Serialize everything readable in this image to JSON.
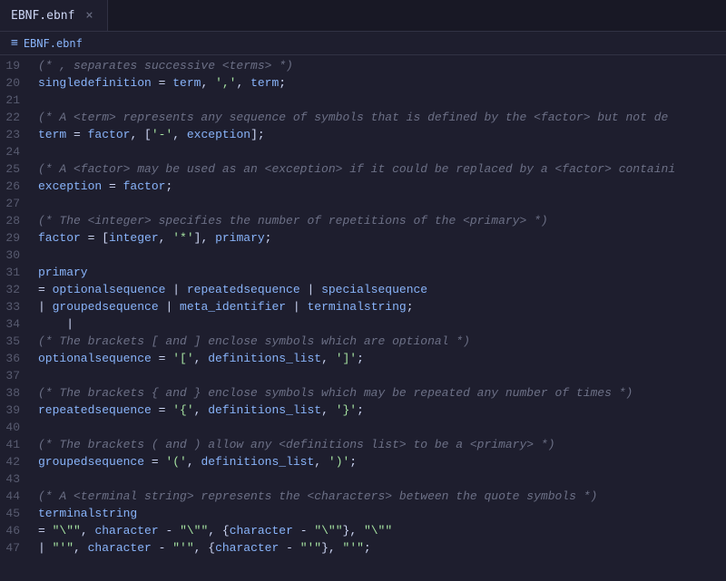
{
  "tab": {
    "label": "EBNF.ebnf",
    "close": "×"
  },
  "breadcrumb": {
    "icon": "≡",
    "path": "EBNF.ebnf"
  },
  "lines": [
    {
      "num": "19",
      "content": [
        {
          "t": "comment",
          "v": "(* , separates successive <terms> *)"
        }
      ]
    },
    {
      "num": "20",
      "content": [
        {
          "t": "identifier",
          "v": "singledefinition"
        },
        {
          "t": "operator",
          "v": " = "
        },
        {
          "t": "identifier",
          "v": "term"
        },
        {
          "t": "punctuation",
          "v": ", "
        },
        {
          "t": "string",
          "v": "','"
        },
        {
          "t": "punctuation",
          "v": ", "
        },
        {
          "t": "identifier",
          "v": "term"
        },
        {
          "t": "punctuation",
          "v": ";"
        }
      ]
    },
    {
      "num": "21",
      "content": []
    },
    {
      "num": "22",
      "content": [
        {
          "t": "comment",
          "v": "(* A <term> represents any sequence of symbols that is defined by the <factor> but not de"
        }
      ]
    },
    {
      "num": "23",
      "content": [
        {
          "t": "identifier",
          "v": "term"
        },
        {
          "t": "operator",
          "v": " = "
        },
        {
          "t": "identifier",
          "v": "factor"
        },
        {
          "t": "punctuation",
          "v": ", "
        },
        {
          "t": "punctuation",
          "v": "["
        },
        {
          "t": "string",
          "v": "'-'"
        },
        {
          "t": "punctuation",
          "v": ", "
        },
        {
          "t": "identifier",
          "v": "exception"
        },
        {
          "t": "punctuation",
          "v": "];"
        }
      ]
    },
    {
      "num": "24",
      "content": []
    },
    {
      "num": "25",
      "content": [
        {
          "t": "comment",
          "v": "(* A <factor> may be used as an <exception> if it could be replaced by a <factor> containi"
        }
      ]
    },
    {
      "num": "26",
      "content": [
        {
          "t": "identifier",
          "v": "exception"
        },
        {
          "t": "operator",
          "v": " = "
        },
        {
          "t": "identifier",
          "v": "factor"
        },
        {
          "t": "punctuation",
          "v": ";"
        }
      ]
    },
    {
      "num": "27",
      "content": []
    },
    {
      "num": "28",
      "content": [
        {
          "t": "comment",
          "v": "(* The <integer> specifies the number of repetitions of the <primary> *)"
        }
      ]
    },
    {
      "num": "29",
      "content": [
        {
          "t": "identifier",
          "v": "factor"
        },
        {
          "t": "operator",
          "v": " = "
        },
        {
          "t": "punctuation",
          "v": "["
        },
        {
          "t": "identifier",
          "v": "integer"
        },
        {
          "t": "punctuation",
          "v": ", "
        },
        {
          "t": "string",
          "v": "'*'"
        },
        {
          "t": "punctuation",
          "v": "], "
        },
        {
          "t": "identifier",
          "v": "primary"
        },
        {
          "t": "punctuation",
          "v": ";"
        }
      ]
    },
    {
      "num": "30",
      "content": []
    },
    {
      "num": "31",
      "content": [
        {
          "t": "identifier",
          "v": "primary"
        }
      ]
    },
    {
      "num": "32",
      "content": [
        {
          "t": "operator",
          "v": "= "
        },
        {
          "t": "identifier",
          "v": "optionalsequence"
        },
        {
          "t": "operator",
          "v": " | "
        },
        {
          "t": "identifier",
          "v": "repeatedsequence"
        },
        {
          "t": "operator",
          "v": " | "
        },
        {
          "t": "identifier",
          "v": "specialsequence"
        }
      ]
    },
    {
      "num": "33",
      "content": [
        {
          "t": "operator",
          "v": "| "
        },
        {
          "t": "identifier",
          "v": "groupedsequence"
        },
        {
          "t": "operator",
          "v": " | "
        },
        {
          "t": "identifier",
          "v": "meta_identifier"
        },
        {
          "t": "operator",
          "v": " | "
        },
        {
          "t": "identifier",
          "v": "terminalstring"
        },
        {
          "t": "punctuation",
          "v": ";"
        }
      ]
    },
    {
      "num": "34",
      "content": [
        {
          "t": "punctuation",
          "v": "    |"
        }
      ]
    },
    {
      "num": "35",
      "content": [
        {
          "t": "comment",
          "v": "(* The brackets [ and ] enclose symbols which are optional *)"
        }
      ]
    },
    {
      "num": "36",
      "content": [
        {
          "t": "identifier",
          "v": "optionalsequence"
        },
        {
          "t": "operator",
          "v": " = "
        },
        {
          "t": "string",
          "v": "'['"
        },
        {
          "t": "punctuation",
          "v": ", "
        },
        {
          "t": "identifier",
          "v": "definitions_list"
        },
        {
          "t": "punctuation",
          "v": ", "
        },
        {
          "t": "string",
          "v": "']'"
        },
        {
          "t": "punctuation",
          "v": ";"
        }
      ]
    },
    {
      "num": "37",
      "content": []
    },
    {
      "num": "38",
      "content": [
        {
          "t": "comment",
          "v": "(* The brackets { and } enclose symbols which may be repeated any number of times *)"
        }
      ]
    },
    {
      "num": "39",
      "content": [
        {
          "t": "identifier",
          "v": "repeatedsequence"
        },
        {
          "t": "operator",
          "v": " = "
        },
        {
          "t": "string",
          "v": "'{'"
        },
        {
          "t": "punctuation",
          "v": ", "
        },
        {
          "t": "identifier",
          "v": "definitions_list"
        },
        {
          "t": "punctuation",
          "v": ", "
        },
        {
          "t": "string",
          "v": "'}'"
        },
        {
          "t": "punctuation",
          "v": ";"
        }
      ]
    },
    {
      "num": "40",
      "content": []
    },
    {
      "num": "41",
      "content": [
        {
          "t": "comment",
          "v": "(* The brackets ( and ) allow any <definitions list> to be a <primary> *)"
        }
      ]
    },
    {
      "num": "42",
      "content": [
        {
          "t": "identifier",
          "v": "groupedsequence"
        },
        {
          "t": "operator",
          "v": " = "
        },
        {
          "t": "string",
          "v": "'('"
        },
        {
          "t": "punctuation",
          "v": ", "
        },
        {
          "t": "identifier",
          "v": "definitions_list"
        },
        {
          "t": "punctuation",
          "v": ", "
        },
        {
          "t": "string",
          "v": "')'"
        },
        {
          "t": "punctuation",
          "v": ";"
        }
      ]
    },
    {
      "num": "43",
      "content": []
    },
    {
      "num": "44",
      "content": [
        {
          "t": "comment",
          "v": "(* A <terminal string> represents the <characters> between the quote symbols *)"
        }
      ]
    },
    {
      "num": "45",
      "content": [
        {
          "t": "identifier",
          "v": "terminalstring"
        }
      ]
    },
    {
      "num": "46",
      "content": [
        {
          "t": "operator",
          "v": "= "
        },
        {
          "t": "string",
          "v": "\"\\\"\""
        },
        {
          "t": "punctuation",
          "v": ", "
        },
        {
          "t": "identifier",
          "v": "character"
        },
        {
          "t": "operator",
          "v": " - "
        },
        {
          "t": "string",
          "v": "\"\\\"\""
        },
        {
          "t": "punctuation",
          "v": ", "
        },
        {
          "t": "punctuation",
          "v": "{"
        },
        {
          "t": "identifier",
          "v": "character"
        },
        {
          "t": "operator",
          "v": " - "
        },
        {
          "t": "string",
          "v": "\"\\\"\""
        },
        {
          "t": "punctuation",
          "v": "}, "
        },
        {
          "t": "string",
          "v": "\"\\\"\""
        }
      ]
    },
    {
      "num": "47",
      "content": [
        {
          "t": "operator",
          "v": "| "
        },
        {
          "t": "string",
          "v": "\"'\""
        },
        {
          "t": "punctuation",
          "v": ", "
        },
        {
          "t": "identifier",
          "v": "character"
        },
        {
          "t": "operator",
          "v": " - "
        },
        {
          "t": "string",
          "v": "\"'\""
        },
        {
          "t": "punctuation",
          "v": ", "
        },
        {
          "t": "punctuation",
          "v": "{"
        },
        {
          "t": "identifier",
          "v": "character"
        },
        {
          "t": "operator",
          "v": " - "
        },
        {
          "t": "string",
          "v": "\"'\""
        },
        {
          "t": "punctuation",
          "v": "}, "
        },
        {
          "t": "string",
          "v": "\"'\""
        },
        {
          "t": "punctuation",
          "v": ";"
        }
      ]
    }
  ],
  "colors": {
    "bg": "#1e1e2e",
    "tab_bg": "#1e1e2e",
    "tab_bar_bg": "#181825",
    "comment": "#6c7086",
    "identifier": "#89b4fa",
    "string": "#a6e3a1",
    "operator": "#cdd6f4",
    "punctuation": "#cdd6f4"
  }
}
